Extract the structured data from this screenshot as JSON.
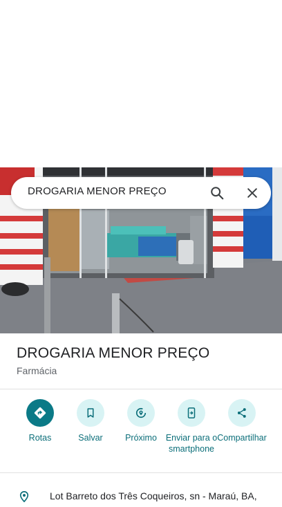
{
  "search": {
    "query": "DROGARIA MENOR PREÇO",
    "search_icon": "search-icon",
    "close_icon": "close-icon"
  },
  "place": {
    "name": "DROGARIA MENOR PREÇO",
    "category": "Farmácia"
  },
  "actions": [
    {
      "label": "Rotas",
      "icon": "directions-icon"
    },
    {
      "label": "Salvar",
      "icon": "bookmark-icon"
    },
    {
      "label": "Próximo",
      "icon": "nearby-icon"
    },
    {
      "label": "Enviar para o smartphone",
      "icon": "send-to-phone-icon"
    },
    {
      "label": "Compartilhar",
      "icon": "share-icon"
    }
  ],
  "address": {
    "text": "Lot Barreto dos Três Coqueiros, sn - Maraú, BA,",
    "icon": "location-pin-icon"
  },
  "colors": {
    "accent": "#0b7a87",
    "accent_light": "#d8f3f4",
    "text_primary": "#202124",
    "text_secondary": "#5f6368"
  }
}
